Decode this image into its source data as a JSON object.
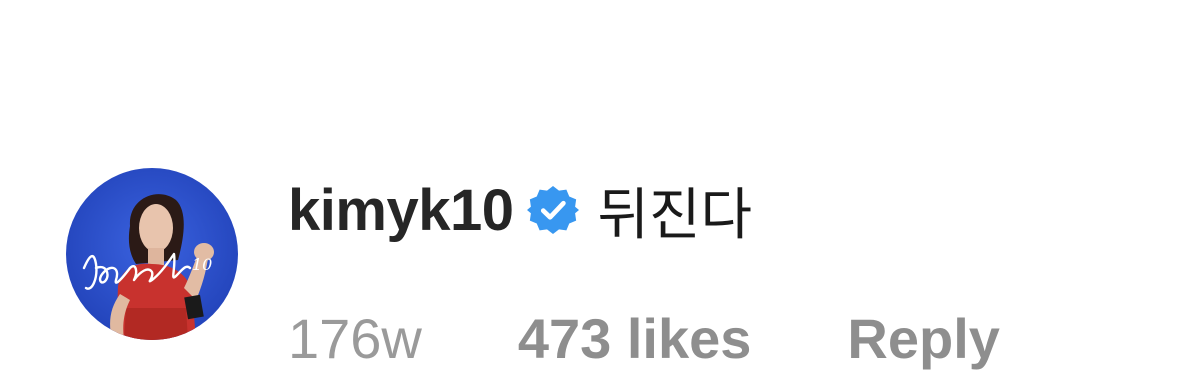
{
  "comment": {
    "username": "kimyk10",
    "verified": true,
    "verified_icon": "verified-badge-icon",
    "text": "뒤진다",
    "time": "176w",
    "likes": "473 likes",
    "reply_label": "Reply",
    "avatar_signature": "Kimyk10"
  },
  "colors": {
    "username": "#262626",
    "meta": "#8e8e8e",
    "verified_badge": "#3897f0",
    "avatar_background": "#2a4fc8"
  }
}
